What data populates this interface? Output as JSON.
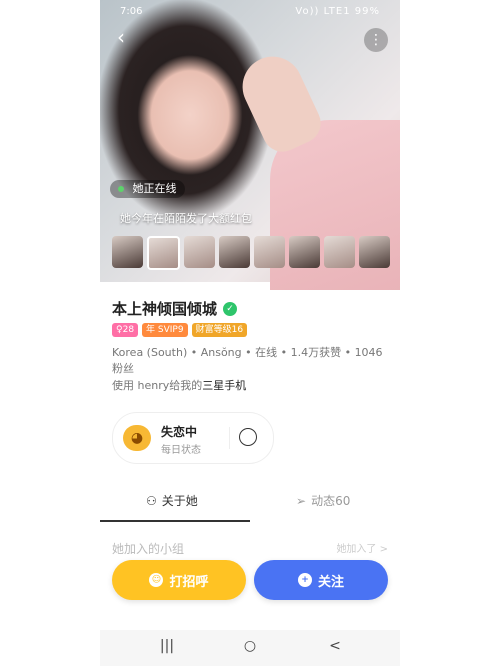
{
  "status_bar": {
    "time": "7:06",
    "signal": "Vo)) LTE1",
    "battery": "99%"
  },
  "hero": {
    "back_icon": "chevron-left-icon",
    "more_icon": "more-dots-icon",
    "online_label": "她正在线",
    "gift_line": "她今年在陌陌发了大额红包",
    "thumb_count_label": ""
  },
  "profile": {
    "name": "本上神倾国倾城",
    "badges": [
      "♀28",
      "年 SVIP9",
      "财富等级16"
    ],
    "meta_line": "Korea (South) • Ansŏng • 在线 • 1.4万获赞 • 1046粉丝",
    "gift_prefix": "使用 henry给我的",
    "gift_highlight": "三星手机"
  },
  "mood": {
    "title": "失恋中",
    "subtitle": "每日状态"
  },
  "tabs": {
    "about": "关于她",
    "moments": "动态60"
  },
  "group": {
    "label": "她加入的小组",
    "right": "她加入了 >"
  },
  "actions": {
    "greet": "打招呼",
    "follow": "关注"
  },
  "navbar": {
    "recent": "|||",
    "home": "○",
    "back": "<"
  }
}
